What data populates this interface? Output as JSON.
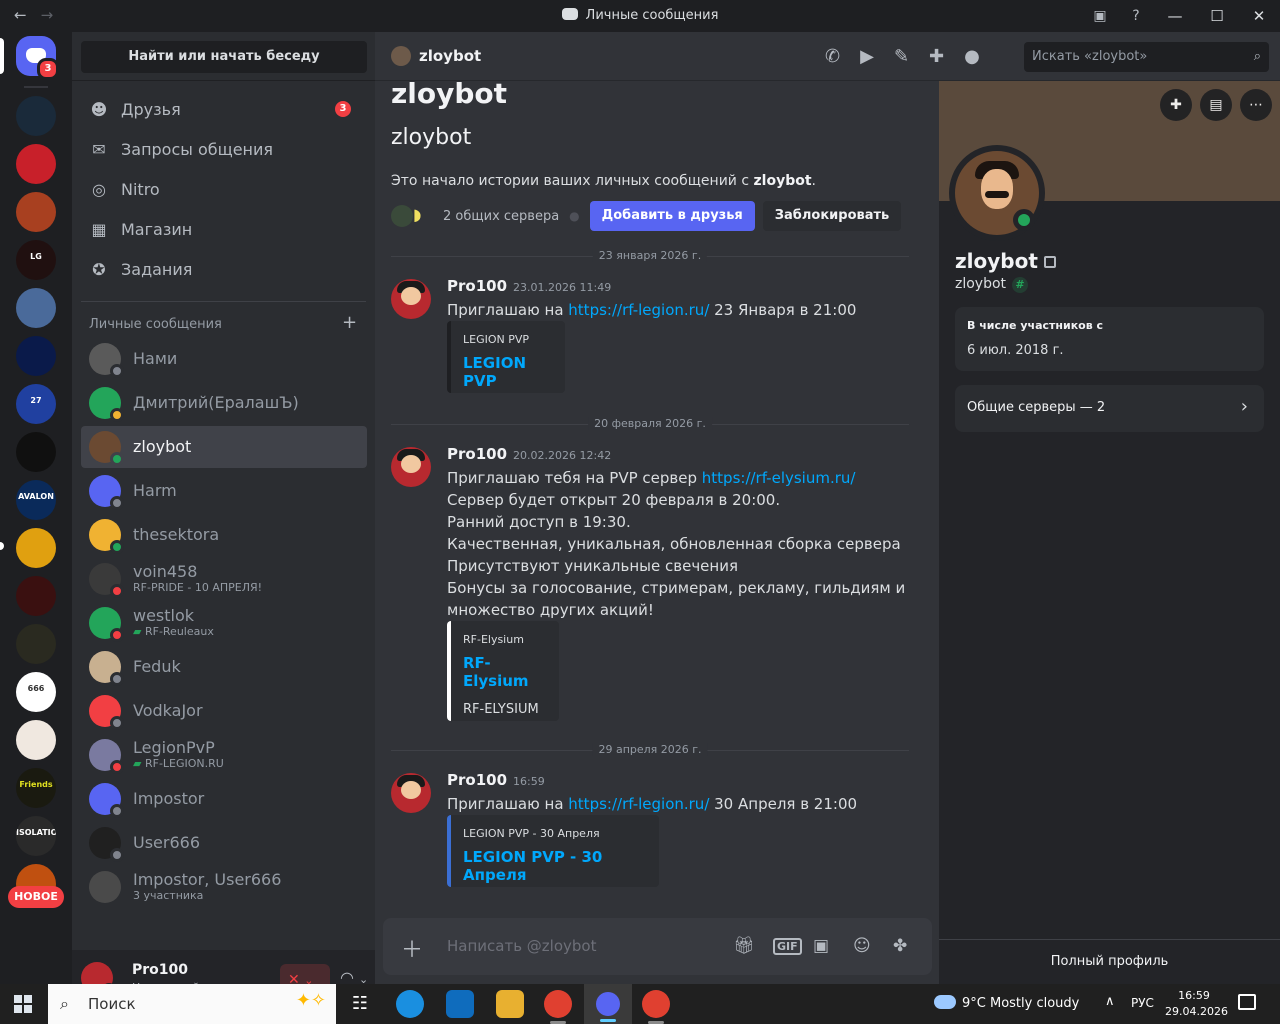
{
  "window": {
    "title": "Личные сообщения",
    "back": "←",
    "forward": "→",
    "help": "?"
  },
  "rail": {
    "home_badge": "3",
    "new_badge": "НОВОЕ",
    "servers": [
      {
        "name": "server-1",
        "color": "#1a2a3a",
        "label": ""
      },
      {
        "name": "server-2",
        "color": "#c8202a",
        "label": ""
      },
      {
        "name": "server-3",
        "color": "#a84020",
        "label": ""
      },
      {
        "name": "server-4",
        "color": "#201010",
        "label": "LG"
      },
      {
        "name": "server-5",
        "color": "#4a6a9a",
        "label": ""
      },
      {
        "name": "server-6",
        "color": "#0a1a4a",
        "label": ""
      },
      {
        "name": "server-7",
        "color": "#2040a0",
        "label": "27"
      },
      {
        "name": "server-8",
        "color": "#101010",
        "label": ""
      },
      {
        "name": "server-9",
        "color": "#0a2a5a",
        "label": "AVALON"
      },
      {
        "name": "server-10",
        "color": "#e0a010",
        "label": ""
      },
      {
        "name": "server-11",
        "color": "#3a1010",
        "label": ""
      },
      {
        "name": "server-12",
        "color": "#2a2a20",
        "label": ""
      },
      {
        "name": "server-13",
        "color": "#ffffff",
        "label": "666"
      },
      {
        "name": "server-14",
        "color": "#f0e8e0",
        "label": ""
      },
      {
        "name": "server-15",
        "color": "#1a1a10",
        "label": "Friends"
      },
      {
        "name": "server-16",
        "color": "#2a2a2a",
        "label": "ISOLATION"
      },
      {
        "name": "server-17",
        "color": "#c05010",
        "label": ""
      }
    ]
  },
  "sidebar": {
    "search_button": "Найти или начать беседу",
    "nav": [
      {
        "label": "Друзья",
        "icon": "friends-icon",
        "glyph": "☻",
        "badge": "3"
      },
      {
        "label": "Запросы общения",
        "icon": "mail-icon",
        "glyph": "✉",
        "badge": ""
      },
      {
        "label": "Nitro",
        "icon": "nitro-icon",
        "glyph": "◎",
        "badge": ""
      },
      {
        "label": "Магазин",
        "icon": "shop-icon",
        "glyph": "▦",
        "badge": ""
      },
      {
        "label": "Задания",
        "icon": "quests-icon",
        "glyph": "✪",
        "badge": ""
      }
    ],
    "dm_header": "Личные сообщения",
    "dm_add": "+",
    "dms": [
      {
        "name": "Нами",
        "sub": "",
        "status": "off",
        "avatar": "#5a5a5a"
      },
      {
        "name": "Дмитрий(ЕралашЪ)",
        "sub": "",
        "status": "idle",
        "avatar": "#23a55a"
      },
      {
        "name": "zloybot",
        "sub": "",
        "status": "on",
        "avatar": "#6b4a32",
        "selected": true
      },
      {
        "name": "Harm",
        "sub": "",
        "status": "off",
        "avatar": "#5865f2"
      },
      {
        "name": "thesektora",
        "sub": "",
        "status": "on",
        "avatar": "#f0b232"
      },
      {
        "name": "voin458",
        "sub": "RF-PRIDE - 10 АПРЕЛЯ!",
        "status": "dnd",
        "avatar": "#3a3a3a"
      },
      {
        "name": "westlok",
        "sub": "RF-Reuleaux",
        "sub_game": true,
        "status": "dnd",
        "avatar": "#23a55a"
      },
      {
        "name": "Feduk",
        "sub": "",
        "status": "off",
        "avatar": "#c8b090"
      },
      {
        "name": "VodkaJor",
        "sub": "",
        "status": "off",
        "avatar": "#f23f43"
      },
      {
        "name": "LegionPvP",
        "sub": "RF-LEGION.RU",
        "sub_game": true,
        "status": "dnd",
        "avatar": "#7a7aa0"
      },
      {
        "name": "Impostor",
        "sub": "",
        "status": "off",
        "avatar": "#5865f2"
      },
      {
        "name": "User666",
        "sub": "",
        "status": "off",
        "avatar": "#202020"
      },
      {
        "name": "Impostor, User666",
        "sub": "3 участника",
        "status": "",
        "avatar": "#4a4a4a"
      }
    ],
    "user": {
      "name": "Pro100",
      "status": "Невидимый"
    }
  },
  "header": {
    "name": "zloybot",
    "search_placeholder": "Искать «zloybot»"
  },
  "intro": {
    "big_name": "zloybot",
    "username": "zloybot",
    "text_before": "Это начало истории ваших личных сообщений с ",
    "text_name": "zloybot",
    "text_after": ".",
    "common_servers": "2 общих сервера",
    "add_friend": "Добавить в друзья",
    "block": "Заблокировать"
  },
  "messages": [
    {
      "divider": "23 января 2026 г.",
      "author": "Pro100",
      "time": "23.01.2026 11:49",
      "lines": [
        {
          "pre": "Приглашаю на ",
          "link": "https://rf-legion.ru/",
          "post": " 23 Января в 21:00"
        }
      ],
      "embed": {
        "provider": "LEGION PVP",
        "title": "LEGION PVP",
        "desc": "",
        "accent": "#1e1f22"
      }
    },
    {
      "divider": "20 февраля 2026 г.",
      "author": "Pro100",
      "time": "20.02.2026 12:42",
      "lines": [
        {
          "pre": "Приглашаю тебя на PVP сервер ",
          "link": "https://rf-elysium.ru/",
          "post": ""
        },
        {
          "pre": "Сервер будет открыт 20 февраля в 20:00.",
          "link": "",
          "post": ""
        },
        {
          "pre": "Ранний доступ в 19:30.",
          "link": "",
          "post": ""
        },
        {
          "pre": "Качественная, уникальная, обновленная сборка сервера",
          "link": "",
          "post": ""
        },
        {
          "pre": "Присутствуют уникальные свечения",
          "link": "",
          "post": ""
        },
        {
          "pre": "Бонусы за голосование, стримерам, рекламу, гильдиям и",
          "link": "",
          "post": ""
        },
        {
          "pre": "множество других акций!",
          "link": "",
          "post": ""
        }
      ],
      "embed": {
        "provider": "RF-Elysium",
        "title": "RF-Elysium",
        "desc": "RF-ELYSIUM",
        "accent": "#ffffff"
      }
    },
    {
      "divider": "29 апреля 2026 г.",
      "author": "Pro100",
      "time": "16:59",
      "lines": [
        {
          "pre": "Приглашаю на ",
          "link": "https://rf-legion.ru/",
          "post": " 30 Апреля в 21:00"
        }
      ],
      "embed": {
        "provider": "LEGION PVP - 30 Апреля",
        "title": "LEGION PVP - 30 Апреля",
        "desc": "",
        "accent": "#3b6fd4"
      }
    }
  ],
  "composer": {
    "placeholder": "Написать @zloybot"
  },
  "profile": {
    "name": "zloybot",
    "username": "zloybot",
    "member_since_label": "В числе участников с",
    "member_since": "6 июл. 2018 г.",
    "mutual_servers": "Общие серверы — 2",
    "full_profile": "Полный профиль"
  },
  "taskbar": {
    "search": "Поиск",
    "weather": "9°C  Mostly cloudy",
    "lang": "РУС",
    "time": "16:59",
    "date": "29.04.2026"
  }
}
